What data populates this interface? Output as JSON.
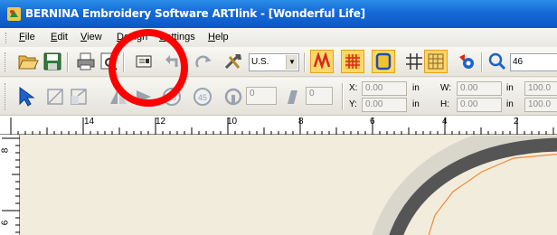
{
  "window": {
    "title": "BERNINA Embroidery Software ARTlink - [Wonderful Life]"
  },
  "menu": {
    "items": [
      {
        "mnemonic": "F",
        "rest": "ile"
      },
      {
        "mnemonic": "E",
        "rest": "dit"
      },
      {
        "mnemonic": "V",
        "rest": "iew"
      },
      {
        "mnemonic": "D",
        "rest": "esign"
      },
      {
        "mnemonic": "S",
        "rest": "ettings"
      },
      {
        "mnemonic": "H",
        "rest": "elp"
      }
    ]
  },
  "toolbar": {
    "units_select": "U.S.",
    "zoom_value": "46"
  },
  "transform": {
    "rotate_angle": "0",
    "slant_angle": "0",
    "x_label": "X:",
    "x_value": "0.00",
    "x_unit": "in",
    "y_label": "Y:",
    "y_value": "0.00",
    "y_unit": "in",
    "w_label": "W:",
    "w_value": "0.00",
    "w_unit": "in",
    "h_label": "H:",
    "h_value": "0.00",
    "h_unit": "in",
    "w_percent": "100.0",
    "h_percent": "100.0"
  },
  "ruler": {
    "h_labels": [
      "14",
      "12",
      "10",
      "8",
      "6",
      "4",
      "2"
    ],
    "v_labels": [
      "8",
      "6"
    ]
  },
  "annotation": {
    "highlight_color": "#ff0000"
  }
}
